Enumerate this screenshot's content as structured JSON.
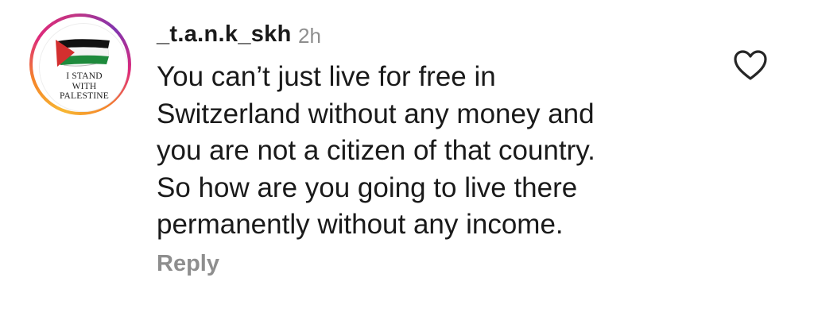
{
  "comment": {
    "avatar": {
      "badge_lines": [
        "I STAND",
        "WITH",
        "PALESTINE"
      ],
      "icon": "palestine-flag",
      "ring_colors": [
        "#f7b733",
        "#f58529",
        "#dd2a7b",
        "#8134af"
      ]
    },
    "username": "_t.a.n.k_skh",
    "timestamp": "2h",
    "text_lines": [
      "You can’t just live for free in",
      "Switzerland without any money and",
      "you are not a citizen of that country.",
      "So how are you going to live there",
      "permanently without any income."
    ],
    "reply_label": "Reply",
    "like_icon": "heart-outline-icon"
  }
}
